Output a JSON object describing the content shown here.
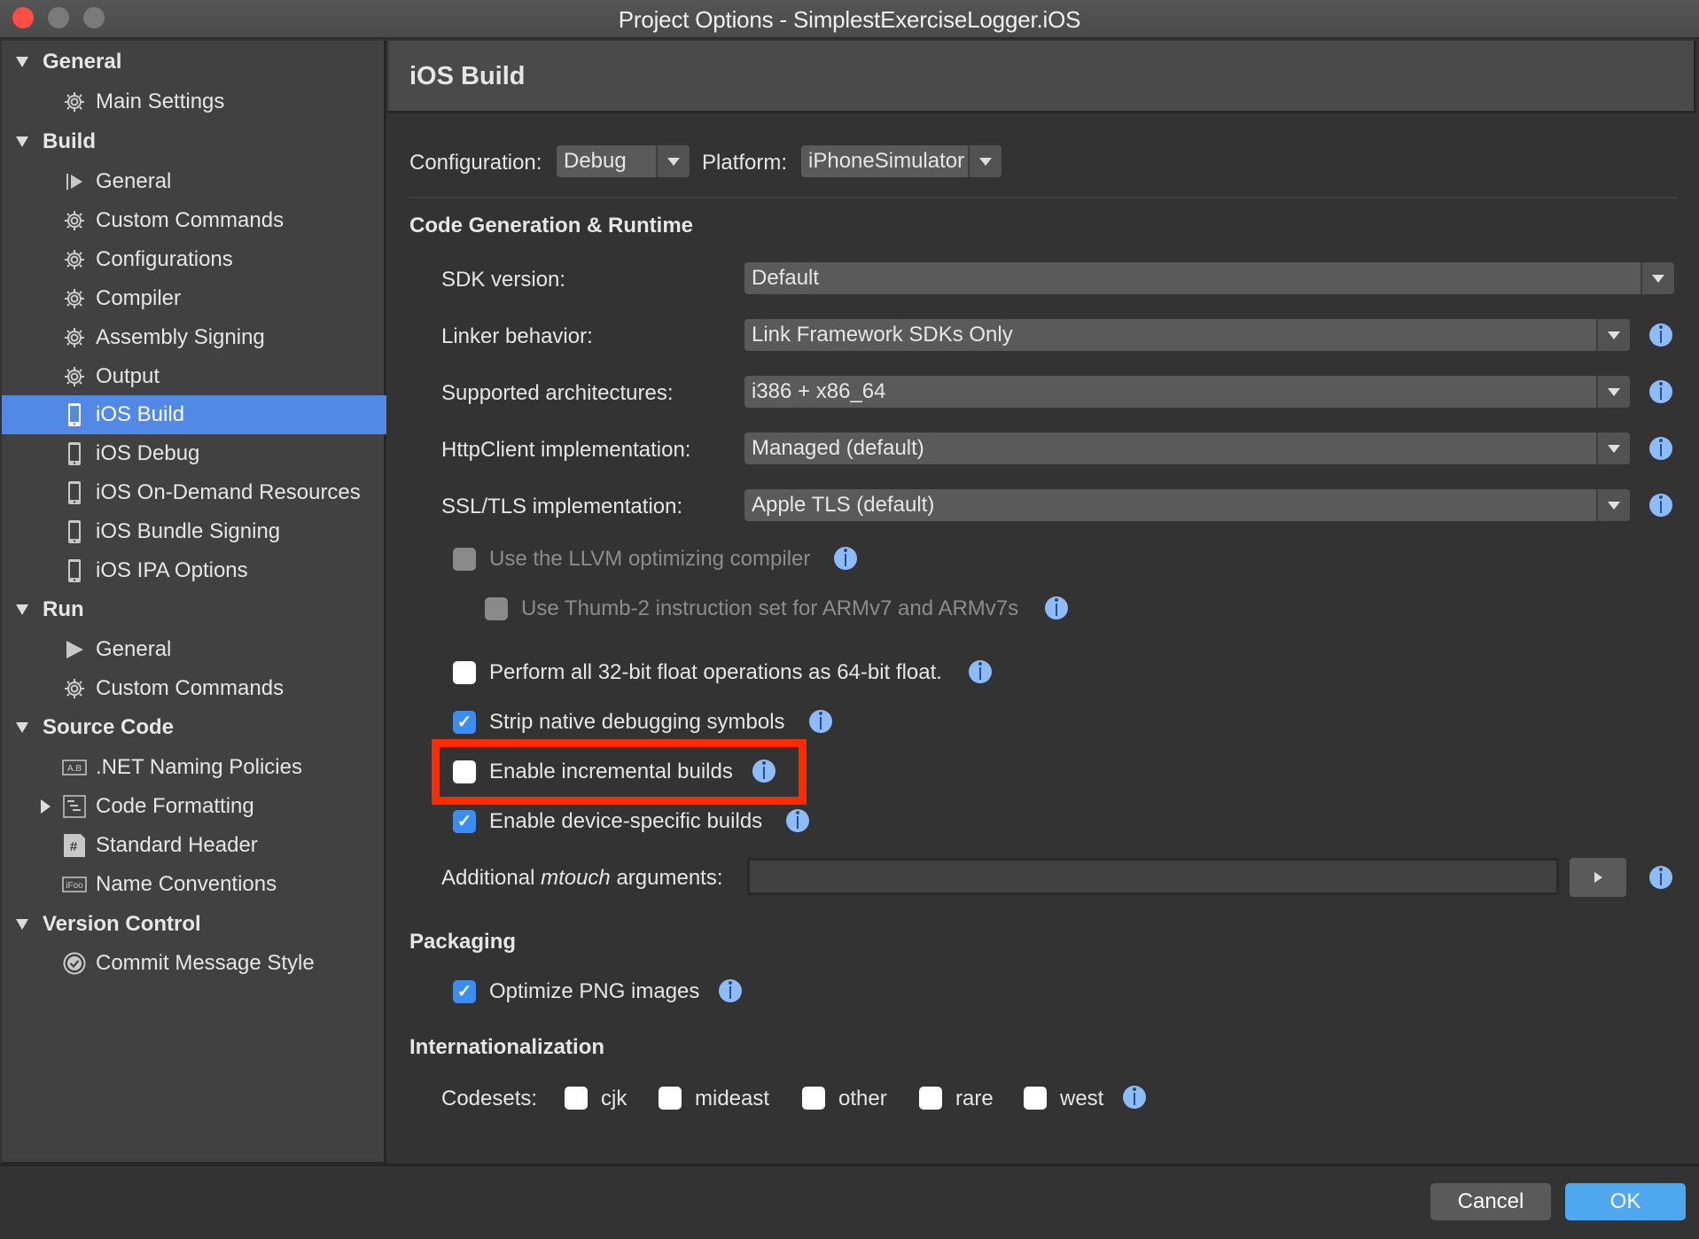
{
  "window": {
    "title": "Project Options - SimplestExerciseLogger.iOS",
    "traffic_lights": [
      "close",
      "minimize",
      "maximize"
    ]
  },
  "sidebar": {
    "selected": "iOS Build",
    "groups": [
      {
        "label": "General",
        "expanded": true,
        "items": [
          {
            "label": "Main Settings",
            "icon": "gear-icon"
          }
        ]
      },
      {
        "label": "Build",
        "expanded": true,
        "items": [
          {
            "label": "General",
            "icon": "play-bar-icon"
          },
          {
            "label": "Custom Commands",
            "icon": "gear-icon"
          },
          {
            "label": "Configurations",
            "icon": "gear-icon"
          },
          {
            "label": "Compiler",
            "icon": "gear-icon"
          },
          {
            "label": "Assembly Signing",
            "icon": "gear-icon"
          },
          {
            "label": "Output",
            "icon": "gear-icon"
          },
          {
            "label": "iOS Build",
            "icon": "phone-icon",
            "selected": true
          },
          {
            "label": "iOS Debug",
            "icon": "phone-icon"
          },
          {
            "label": "iOS On-Demand Resources",
            "icon": "phone-icon"
          },
          {
            "label": "iOS Bundle Signing",
            "icon": "phone-icon"
          },
          {
            "label": "iOS IPA Options",
            "icon": "phone-icon"
          }
        ]
      },
      {
        "label": "Run",
        "expanded": true,
        "items": [
          {
            "label": "General",
            "icon": "play-icon"
          },
          {
            "label": "Custom Commands",
            "icon": "gear-icon"
          }
        ]
      },
      {
        "label": "Source Code",
        "expanded": true,
        "items": [
          {
            "label": ".NET Naming Policies",
            "icon": "naming-policy-icon",
            "icon_text": "A.B"
          },
          {
            "label": "Code Formatting",
            "icon": "code-format-icon",
            "collapsed_children": true
          },
          {
            "label": "Standard Header",
            "icon": "hash-document-icon",
            "icon_text": "#"
          },
          {
            "label": "Name Conventions",
            "icon": "name-convention-icon",
            "icon_text": "iFoo"
          }
        ]
      },
      {
        "label": "Version Control",
        "expanded": true,
        "items": [
          {
            "label": "Commit Message Style",
            "icon": "checkmark-circle-icon"
          }
        ]
      }
    ]
  },
  "main": {
    "header": "iOS Build",
    "configuration_label": "Configuration:",
    "configuration_value": "Debug",
    "platform_label": "Platform:",
    "platform_value": "iPhoneSimulator",
    "code_gen_section": "Code Generation & Runtime",
    "sdk_label": "SDK version:",
    "sdk_value": "Default",
    "linker_label": "Linker behavior:",
    "linker_value": "Link Framework SDKs Only",
    "arch_label": "Supported architectures:",
    "arch_value": "i386 + x86_64",
    "httpclient_label": "HttpClient implementation:",
    "httpclient_value": "Managed (default)",
    "ssl_label": "SSL/TLS implementation:",
    "ssl_value": "Apple TLS (default)",
    "options": [
      {
        "label": "Use the LLVM optimizing compiler",
        "checked": false,
        "enabled": false
      },
      {
        "label": "Use Thumb-2 instruction set for ARMv7 and ARMv7s",
        "checked": false,
        "enabled": false
      },
      {
        "label": "Perform all 32-bit float operations as 64-bit float.",
        "checked": false,
        "enabled": true
      },
      {
        "label": "Strip native debugging symbols",
        "checked": true,
        "enabled": true
      },
      {
        "label": "Enable incremental builds",
        "checked": false,
        "enabled": true,
        "highlighted": true
      },
      {
        "label": "Enable device-specific builds",
        "checked": true,
        "enabled": true
      }
    ],
    "mtouch_label_pre": "Additional ",
    "mtouch_label_em": "mtouch",
    "mtouch_label_post": " arguments:",
    "mtouch_value": "",
    "packaging_section": "Packaging",
    "optimize_png_label": "Optimize PNG images",
    "optimize_png_checked": true,
    "i18n_section": "Internationalization",
    "codesets_label": "Codesets:",
    "codesets": [
      {
        "label": "cjk",
        "checked": false
      },
      {
        "label": "mideast",
        "checked": false
      },
      {
        "label": "other",
        "checked": false
      },
      {
        "label": "rare",
        "checked": false
      },
      {
        "label": "west",
        "checked": false
      }
    ]
  },
  "footer": {
    "cancel_label": "Cancel",
    "ok_label": "OK"
  },
  "colors": {
    "selection": "#5289e6",
    "checkbox_checked": "#3a8df5",
    "info_icon": "#8ebcf9",
    "ok_button": "#4fa7f0",
    "highlight_box": "#ff2a00",
    "close_light": "#fc4e44"
  }
}
